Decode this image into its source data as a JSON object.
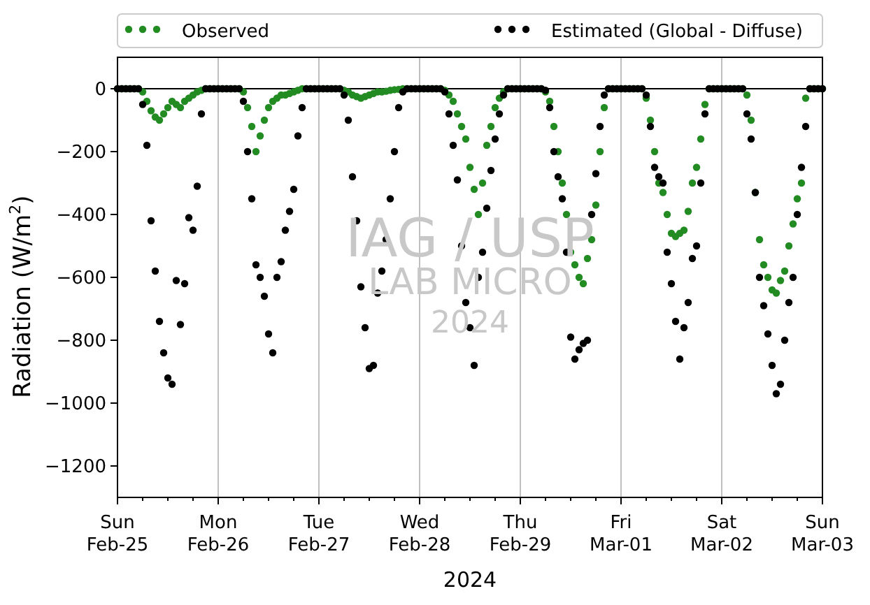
{
  "chart": {
    "chart_data": {
      "type": "scatter",
      "xlabel": "2024",
      "ylabel": "Radiation (W/m$^{2}$)",
      "legend": "top",
      "ylim": [
        -1300,
        100
      ],
      "yticks": [
        {
          "value": 0,
          "label": "0"
        },
        {
          "value": -200,
          "label": "−200"
        },
        {
          "value": -400,
          "label": "−400"
        },
        {
          "value": -600,
          "label": "−600"
        },
        {
          "value": -800,
          "label": "−800"
        },
        {
          "value": -1000,
          "label": "−1000"
        },
        {
          "value": -1200,
          "label": "−1200"
        }
      ],
      "categories": [
        "Sun\nFeb-25",
        null,
        null,
        null,
        null,
        null,
        null,
        null,
        null,
        null,
        null,
        null,
        null,
        null,
        null,
        null,
        null,
        null,
        null,
        null,
        null,
        null,
        null,
        null,
        "Mon\nFeb-26",
        null,
        null,
        null,
        null,
        null,
        null,
        null,
        null,
        null,
        null,
        null,
        null,
        null,
        null,
        null,
        null,
        null,
        null,
        null,
        null,
        null,
        null,
        null,
        "Tue\nFeb-27",
        null,
        null,
        null,
        null,
        null,
        null,
        null,
        null,
        null,
        null,
        null,
        null,
        null,
        null,
        null,
        null,
        null,
        null,
        null,
        null,
        null,
        null,
        null,
        "Wed\nFeb-28",
        null,
        null,
        null,
        null,
        null,
        null,
        null,
        null,
        null,
        null,
        null,
        null,
        null,
        null,
        null,
        null,
        null,
        null,
        null,
        null,
        null,
        null,
        null,
        "Thu\nFeb-29",
        null,
        null,
        null,
        null,
        null,
        null,
        null,
        null,
        null,
        null,
        null,
        null,
        null,
        null,
        null,
        null,
        null,
        null,
        null,
        null,
        null,
        null,
        null,
        "Fri\nMar-01",
        null,
        null,
        null,
        null,
        null,
        null,
        null,
        null,
        null,
        null,
        null,
        null,
        null,
        null,
        null,
        null,
        null,
        null,
        null,
        null,
        null,
        null,
        null,
        "Sat\nMar-02",
        null,
        null,
        null,
        null,
        null,
        null,
        null,
        null,
        null,
        null,
        null,
        null,
        null,
        null,
        null,
        null,
        null,
        null,
        null,
        null,
        null,
        null,
        null,
        "Sun\nMar-03"
      ],
      "series": [
        {
          "name": "Observed",
          "color": "#228b22",
          "values": [
            0,
            0,
            0,
            0,
            0,
            0,
            -10,
            -40,
            -70,
            -90,
            -100,
            -80,
            -60,
            -40,
            -50,
            -60,
            -40,
            -30,
            -20,
            -10,
            -5,
            0,
            0,
            0,
            0,
            0,
            0,
            0,
            0,
            0,
            -10,
            -60,
            -120,
            -200,
            -150,
            -100,
            -60,
            -40,
            -30,
            -20,
            -20,
            -15,
            -10,
            -5,
            0,
            0,
            0,
            0,
            0,
            0,
            0,
            0,
            0,
            0,
            -5,
            -10,
            -20,
            -25,
            -30,
            -25,
            -20,
            -15,
            -10,
            -10,
            -8,
            -5,
            -3,
            -2,
            0,
            0,
            0,
            0,
            0,
            0,
            0,
            0,
            0,
            0,
            -5,
            -20,
            -40,
            -80,
            -120,
            -160,
            -250,
            -320,
            -400,
            -300,
            -180,
            -120,
            -60,
            -30,
            -10,
            0,
            0,
            0,
            0,
            0,
            0,
            0,
            0,
            0,
            -10,
            -40,
            -120,
            -200,
            -300,
            -400,
            -520,
            -560,
            -600,
            -620,
            -540,
            -480,
            -370,
            -200,
            -60,
            0,
            0,
            0,
            0,
            0,
            0,
            0,
            0,
            0,
            -30,
            -100,
            -200,
            -300,
            -330,
            -400,
            -460,
            -470,
            -460,
            -450,
            -390,
            -300,
            -250,
            -160,
            -50,
            0,
            0,
            0,
            0,
            0,
            0,
            0,
            0,
            0,
            -20,
            -100,
            -330,
            -480,
            -560,
            -600,
            -640,
            -650,
            -610,
            -580,
            -500,
            -430,
            -350,
            -300,
            -30,
            0,
            0,
            0,
            0
          ]
        },
        {
          "name": "Estimated (Global - Diffuse)",
          "color": "#000000",
          "values": [
            0,
            0,
            0,
            0,
            0,
            0,
            -50,
            -180,
            -420,
            -580,
            -740,
            -840,
            -920,
            -940,
            -610,
            -750,
            -620,
            -410,
            -450,
            -310,
            -80,
            0,
            0,
            0,
            0,
            0,
            0,
            0,
            0,
            0,
            -40,
            -200,
            -350,
            -560,
            -600,
            -660,
            -780,
            -840,
            -600,
            -550,
            -450,
            -390,
            -320,
            -150,
            -60,
            0,
            0,
            0,
            0,
            0,
            0,
            0,
            0,
            0,
            -20,
            -100,
            -280,
            -420,
            -630,
            -760,
            -890,
            -880,
            -650,
            -580,
            -480,
            -350,
            -200,
            -60,
            -10,
            0,
            0,
            0,
            0,
            0,
            0,
            0,
            0,
            0,
            -10,
            -80,
            -180,
            -290,
            -500,
            -680,
            -760,
            -880,
            -600,
            -520,
            -380,
            -260,
            -160,
            -80,
            -20,
            0,
            0,
            0,
            0,
            0,
            0,
            0,
            0,
            0,
            -5,
            -60,
            -200,
            -280,
            -350,
            -520,
            -790,
            -860,
            -830,
            -810,
            -800,
            -400,
            -270,
            -120,
            -20,
            0,
            0,
            0,
            0,
            0,
            0,
            0,
            0,
            0,
            -20,
            -120,
            -250,
            -280,
            -300,
            -520,
            -620,
            -740,
            -860,
            -760,
            -680,
            -540,
            -500,
            -300,
            -80,
            0,
            0,
            0,
            0,
            0,
            0,
            0,
            0,
            0,
            -80,
            -160,
            -330,
            -600,
            -690,
            -780,
            -880,
            -970,
            -940,
            -800,
            -680,
            -600,
            -400,
            -250,
            -120,
            0,
            0,
            0,
            0
          ]
        }
      ],
      "annotations": [
        {
          "text": "IAG / USP"
        },
        {
          "text": "LAB MICRO"
        },
        {
          "text": "2024"
        }
      ]
    }
  }
}
